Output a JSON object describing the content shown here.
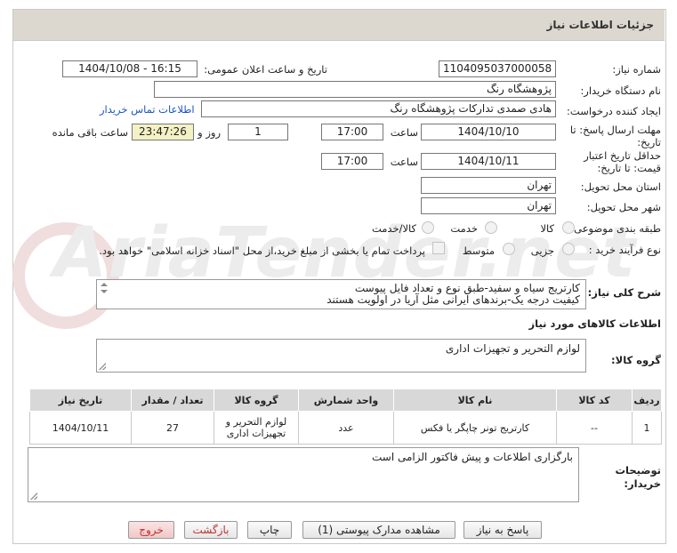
{
  "header": {
    "title": "جزئیات اطلاعات نیاز"
  },
  "fields": {
    "need_number_label": "شماره نیاز:",
    "need_number": "1104095037000058",
    "announce_label": "تاریخ و ساعت اعلان عمومی:",
    "announce_value": "1404/10/08 - 16:15",
    "buyer_label": "نام دستگاه خریدار:",
    "buyer_value": "پژوهشگاه رنگ",
    "creator_label": "ایجاد کننده درخواست:",
    "creator_value": "هادی صمدی تدارکات پژوهشگاه رنگ",
    "contact_link": "اطلاعات تماس خریدار",
    "deadline_label_1": "مهلت ارسال پاسخ: تا",
    "deadline_label_2": "تاریخ:",
    "deadline_date": "1404/10/10",
    "time_label": "ساعت",
    "deadline_time": "17:00",
    "days_value": "1",
    "days_label": "روز و",
    "remaining_value": "23:47:26",
    "remaining_label": "ساعت باقی مانده",
    "validity_label_1": "حداقل تاریخ اعتبار",
    "validity_label_2": "قیمت: تا تاریخ:",
    "validity_date": "1404/10/11",
    "validity_time": "17:00",
    "province_label": "استان محل تحویل:",
    "province_value": "تهران",
    "city_label": "شهر محل تحویل:",
    "city_value": "تهران",
    "category_label": "طبقه بندی موضوعی:",
    "category_options": [
      "کالا",
      "خدمت",
      "کالا/خدمت"
    ],
    "process_label": "نوع فرآیند خرید :",
    "process_options": [
      "جزیی",
      "متوسط"
    ],
    "payment_note": "پرداخت تمام یا بخشی از مبلغ خرید،از محل \"اسناد خزانه اسلامی\" خواهد بود."
  },
  "description": {
    "label": "شرح کلی نیاز:",
    "line1": "کارتریج سیاه و سفید-طبق نوع و تعداد فایل پیوست",
    "line2": "کیفیت درجه یک-برندهای ایرانی مثل آریا در اولویت هستند"
  },
  "goods": {
    "section_title": "اطلاعات کالاهای مورد نیاز",
    "group_label": "گروه کالا:",
    "group_value": "لوازم التحریر و تجهیزات اداری"
  },
  "table": {
    "headers": [
      "ردیف",
      "کد کالا",
      "نام کالا",
      "واحد شمارش",
      "گروه کالا",
      "تعداد / مقدار",
      "تاریخ نیاز"
    ],
    "rows": [
      {
        "row": "1",
        "code": "--",
        "name": "کارتریج تونر چاپگر یا فکس",
        "unit": "عدد",
        "group": "لوازم التحریر و تجهیزات اداری",
        "qty": "27",
        "date": "1404/10/11"
      }
    ]
  },
  "buyer_notes": {
    "label_1": "توضیحات",
    "label_2": "خریدار:",
    "text": "بارگزاری اطلاعات و پیش فاکتور الزامی است"
  },
  "buttons": {
    "reply": "پاسخ به نیاز",
    "attachments": "مشاهده مدارک پیوستی (1)",
    "print": "چاپ",
    "back": "بازگشت",
    "exit": "خروج"
  },
  "watermark": "AriaTender.net"
}
